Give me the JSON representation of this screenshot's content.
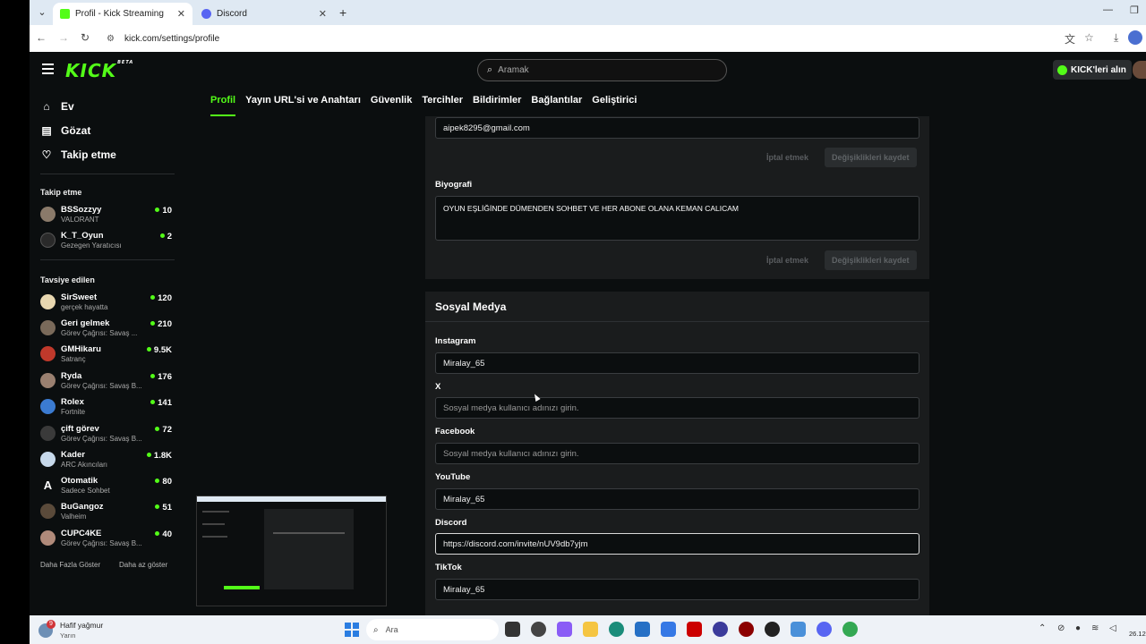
{
  "browser": {
    "tabs": [
      {
        "title": "Profil - Kick Streaming",
        "active": true
      },
      {
        "title": "Discord",
        "active": false
      }
    ],
    "url": "kick.com/settings/profile"
  },
  "site": {
    "logo": "KICK",
    "logo_badge": "BETA",
    "search_placeholder": "Aramak",
    "get_kick_label": "KICK'leri alın"
  },
  "sidebar": {
    "nav": [
      {
        "label": "Ev",
        "icon": "home-icon"
      },
      {
        "label": "Gözat",
        "icon": "browse-icon"
      },
      {
        "label": "Takip etme",
        "icon": "heart-icon"
      }
    ],
    "following_title": "Takip etme",
    "following": [
      {
        "name": "BSSozzyy",
        "sub": "VALORANT",
        "viewers": "10",
        "color": "#8a7a6a"
      },
      {
        "name": "K_T_Oyun",
        "sub": "Gezegen Yaratıcısı",
        "viewers": "2",
        "color": "#2a2a2a"
      }
    ],
    "recommended_title": "Tavsiye edilen",
    "recommended": [
      {
        "name": "SirSweet",
        "sub": "gerçek hayatta",
        "viewers": "120",
        "color": "#e8d7b0"
      },
      {
        "name": "Geri gelmek",
        "sub": "Görev Çağrısı: Savaş ...",
        "viewers": "210",
        "color": "#7a6a5a"
      },
      {
        "name": "GMHikaru",
        "sub": "Satranç",
        "viewers": "9.5K",
        "color": "#c0392b"
      },
      {
        "name": "Ryda",
        "sub": "Görev Çağrısı: Savaş B...",
        "viewers": "176",
        "color": "#9a8070"
      },
      {
        "name": "Rolex",
        "sub": "Fortnite",
        "viewers": "141",
        "color": "#3b7bd1"
      },
      {
        "name": "çift görev",
        "sub": "Görev Çağrısı: Savaş B...",
        "viewers": "72",
        "color": "#3a3a3a"
      },
      {
        "name": "Kader",
        "sub": "ARC Akıncıları",
        "viewers": "1.8K",
        "color": "#c6d8ea"
      },
      {
        "name": "Otomatik",
        "sub": "Sadece Sohbet",
        "viewers": "80",
        "color": "#0b0e0f"
      },
      {
        "name": "BuGangoz",
        "sub": "Valheim",
        "viewers": "51",
        "color": "#5a4a3a"
      },
      {
        "name": "CUPC4KE",
        "sub": "Görev Çağrısı: Savaş B...",
        "viewers": "40",
        "color": "#b08a7a"
      }
    ],
    "show_more": "Daha Fazla Göster",
    "show_less": "Daha az göster"
  },
  "settings_tabs": [
    "Profil",
    "Yayın URL'si ve Anahtarı",
    "Güvenlik",
    "Tercihler",
    "Bildirimler",
    "Bağlantılar",
    "Geliştirici"
  ],
  "profile": {
    "email_value": "aipek8295@gmail.com",
    "cancel_label": "İptal etmek",
    "save_label": "Değişiklikleri kaydet",
    "bio_label": "Biyografi",
    "bio_value": "OYUN EŞLİĞİNDE DÜMENDEN SOHBET VE HER ABONE OLANA KEMAN CALICAM"
  },
  "social": {
    "title": "Sosyal Medya",
    "fields": [
      {
        "label": "Instagram",
        "value": "Miralay_65",
        "placeholder": ""
      },
      {
        "label": "X",
        "value": "",
        "placeholder": "Sosyal medya kullanıcı adınızı girin."
      },
      {
        "label": "Facebook",
        "value": "",
        "placeholder": "Sosyal medya kullanıcı adınızı girin."
      },
      {
        "label": "YouTube",
        "value": "Miralay_65",
        "placeholder": ""
      },
      {
        "label": "Discord",
        "value": "https://discord.com/invite/nUV9db7yjm",
        "placeholder": ""
      },
      {
        "label": "TikTok",
        "value": "Miralay_65",
        "placeholder": ""
      }
    ]
  },
  "taskbar": {
    "weather_badge": "9",
    "weather_text": "Hafif yağmur",
    "weather_sub": "Yarın",
    "search_label": "Ara",
    "clock": "26.12"
  }
}
